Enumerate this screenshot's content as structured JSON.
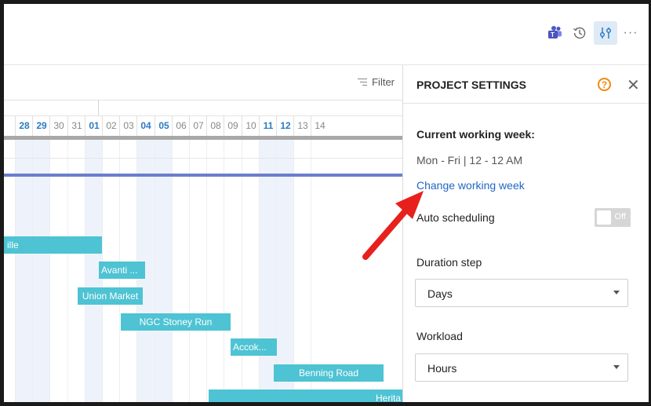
{
  "toolbar": {
    "teams_icon": "teams-icon",
    "history_icon": "history-icon",
    "settings_icon": "project-settings-icon",
    "more_label": "···"
  },
  "gantt": {
    "filter_label": "Filter",
    "days": [
      {
        "label": "28",
        "highlight": true
      },
      {
        "label": "29",
        "highlight": true
      },
      {
        "label": "30",
        "highlight": false
      },
      {
        "label": "31",
        "highlight": false
      },
      {
        "label": "01",
        "highlight": true
      },
      {
        "label": "02",
        "highlight": false
      },
      {
        "label": "03",
        "highlight": false
      },
      {
        "label": "04",
        "highlight": true
      },
      {
        "label": "05",
        "highlight": true
      },
      {
        "label": "06",
        "highlight": false
      },
      {
        "label": "07",
        "highlight": false
      },
      {
        "label": "08",
        "highlight": false
      },
      {
        "label": "09",
        "highlight": false
      },
      {
        "label": "10",
        "highlight": false
      },
      {
        "label": "11",
        "highlight": true
      },
      {
        "label": "12",
        "highlight": true
      },
      {
        "label": "13",
        "highlight": false
      },
      {
        "label": "14",
        "highlight": false
      }
    ],
    "tasks": [
      {
        "label": "ille"
      },
      {
        "label": "Avanti ..."
      },
      {
        "label": "Union Market"
      },
      {
        "label": "NGC Stoney Run"
      },
      {
        "label": "Accok..."
      },
      {
        "label": "Benning Road"
      },
      {
        "label": "Herita"
      }
    ],
    "colors": {
      "task": "#4ec3d3",
      "summary_bar": "#6b7ecb",
      "today_col": "#eef3fb"
    }
  },
  "panel": {
    "title": "PROJECT SETTINGS",
    "help_icon": "?",
    "close_icon": "✕",
    "working_week_label": "Current working week:",
    "working_week_value": "Mon - Fri | 12 - 12 AM",
    "change_link": "Change working week",
    "auto_scheduling_label": "Auto scheduling",
    "auto_scheduling_state": "Off",
    "duration_step_label": "Duration step",
    "duration_step_value": "Days",
    "workload_label": "Workload",
    "workload_value": "Hours"
  },
  "annotation": {
    "arrow_color": "#e8201d"
  }
}
